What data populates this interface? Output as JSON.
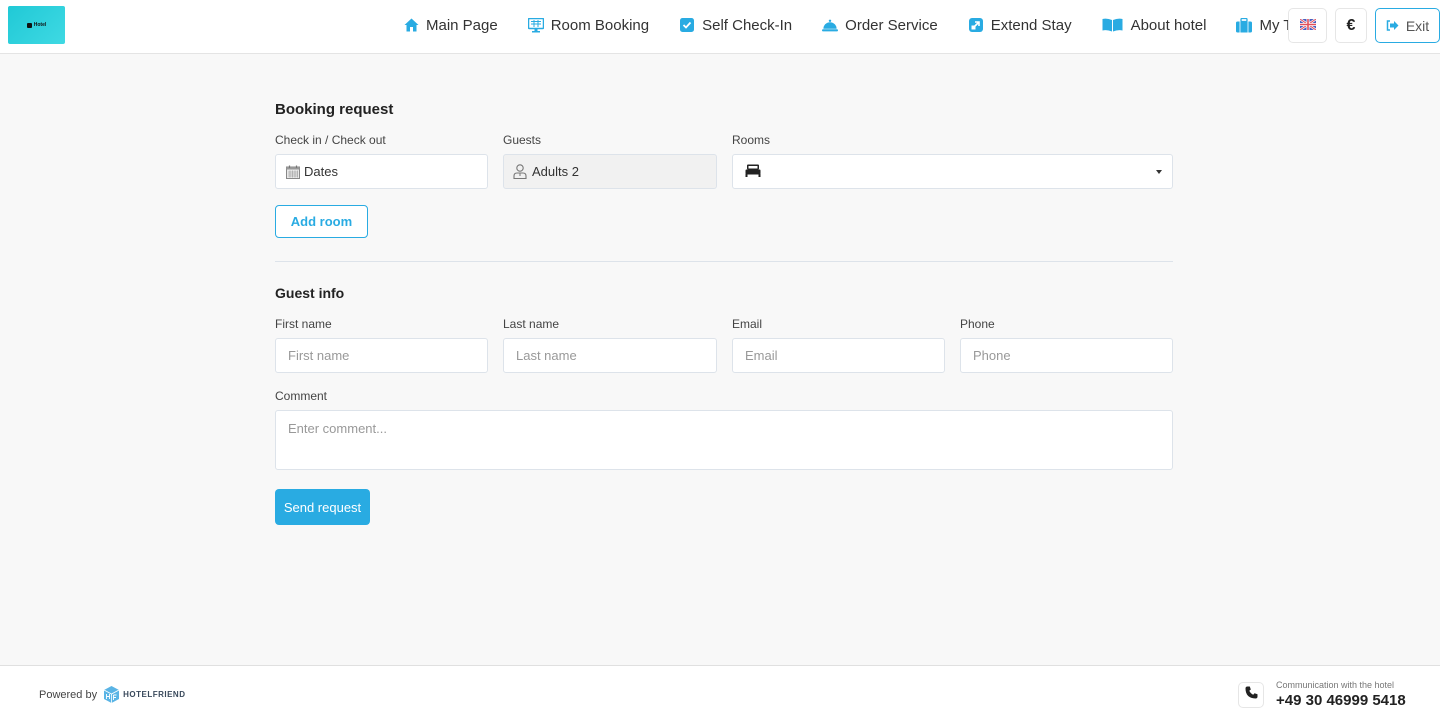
{
  "header": {
    "logo_text": "Hotel",
    "nav": [
      {
        "label": "Main Page",
        "icon": "home-icon"
      },
      {
        "label": "Room Booking",
        "icon": "monitor-icon"
      },
      {
        "label": "Self Check-In",
        "icon": "checkbox-icon"
      },
      {
        "label": "Order Service",
        "icon": "service-bell-icon"
      },
      {
        "label": "Extend Stay",
        "icon": "extend-icon"
      },
      {
        "label": "About hotel",
        "icon": "book-icon"
      },
      {
        "label": "My Trips",
        "icon": "suitcase-icon"
      }
    ],
    "language": "English (UK)",
    "currency_symbol": "€",
    "exit_label": "Exit"
  },
  "booking": {
    "title": "Booking request",
    "checkin_label": "Check in / Check out",
    "dates_value": "Dates",
    "guests_label": "Guests",
    "guests_value": "Adults 2",
    "rooms_label": "Rooms",
    "rooms_value": "",
    "add_room_label": "Add room"
  },
  "guest_info": {
    "title": "Guest info",
    "first_name": {
      "label": "First name",
      "placeholder": "First name"
    },
    "last_name": {
      "label": "Last name",
      "placeholder": "Last name"
    },
    "email": {
      "label": "Email",
      "placeholder": "Email"
    },
    "phone": {
      "label": "Phone",
      "placeholder": "Phone"
    },
    "comment": {
      "label": "Comment",
      "placeholder": "Enter comment..."
    },
    "send_label": "Send request"
  },
  "footer": {
    "powered_by": "Powered by",
    "brand": "HOTELFRIEND",
    "contact_caption": "Communication with the hotel",
    "contact_phone": "+49 30 46999 5418"
  },
  "colors": {
    "accent": "#29abe2",
    "logo_bg": "#20c9d6",
    "page_bg": "#f8f8f8"
  }
}
